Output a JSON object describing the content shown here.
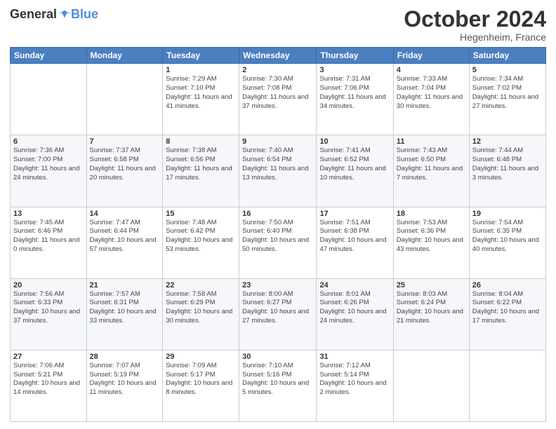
{
  "header": {
    "logo": {
      "general": "General",
      "blue": "Blue"
    },
    "title": "October 2024",
    "location": "Hegenheim, France"
  },
  "calendar": {
    "days_of_week": [
      "Sunday",
      "Monday",
      "Tuesday",
      "Wednesday",
      "Thursday",
      "Friday",
      "Saturday"
    ],
    "weeks": [
      [
        null,
        null,
        {
          "day": 1,
          "sunrise": "7:29 AM",
          "sunset": "7:10 PM",
          "daylight": "11 hours and 41 minutes."
        },
        {
          "day": 2,
          "sunrise": "7:30 AM",
          "sunset": "7:08 PM",
          "daylight": "11 hours and 37 minutes."
        },
        {
          "day": 3,
          "sunrise": "7:31 AM",
          "sunset": "7:06 PM",
          "daylight": "11 hours and 34 minutes."
        },
        {
          "day": 4,
          "sunrise": "7:33 AM",
          "sunset": "7:04 PM",
          "daylight": "11 hours and 30 minutes."
        },
        {
          "day": 5,
          "sunrise": "7:34 AM",
          "sunset": "7:02 PM",
          "daylight": "11 hours and 27 minutes."
        }
      ],
      [
        {
          "day": 6,
          "sunrise": "7:36 AM",
          "sunset": "7:00 PM",
          "daylight": "11 hours and 24 minutes."
        },
        {
          "day": 7,
          "sunrise": "7:37 AM",
          "sunset": "6:58 PM",
          "daylight": "11 hours and 20 minutes."
        },
        {
          "day": 8,
          "sunrise": "7:38 AM",
          "sunset": "6:56 PM",
          "daylight": "11 hours and 17 minutes."
        },
        {
          "day": 9,
          "sunrise": "7:40 AM",
          "sunset": "6:54 PM",
          "daylight": "11 hours and 13 minutes."
        },
        {
          "day": 10,
          "sunrise": "7:41 AM",
          "sunset": "6:52 PM",
          "daylight": "11 hours and 10 minutes."
        },
        {
          "day": 11,
          "sunrise": "7:43 AM",
          "sunset": "6:50 PM",
          "daylight": "11 hours and 7 minutes."
        },
        {
          "day": 12,
          "sunrise": "7:44 AM",
          "sunset": "6:48 PM",
          "daylight": "11 hours and 3 minutes."
        }
      ],
      [
        {
          "day": 13,
          "sunrise": "7:45 AM",
          "sunset": "6:46 PM",
          "daylight": "11 hours and 0 minutes."
        },
        {
          "day": 14,
          "sunrise": "7:47 AM",
          "sunset": "6:44 PM",
          "daylight": "10 hours and 57 minutes."
        },
        {
          "day": 15,
          "sunrise": "7:48 AM",
          "sunset": "6:42 PM",
          "daylight": "10 hours and 53 minutes."
        },
        {
          "day": 16,
          "sunrise": "7:50 AM",
          "sunset": "6:40 PM",
          "daylight": "10 hours and 50 minutes."
        },
        {
          "day": 17,
          "sunrise": "7:51 AM",
          "sunset": "6:38 PM",
          "daylight": "10 hours and 47 minutes."
        },
        {
          "day": 18,
          "sunrise": "7:53 AM",
          "sunset": "6:36 PM",
          "daylight": "10 hours and 43 minutes."
        },
        {
          "day": 19,
          "sunrise": "7:54 AM",
          "sunset": "6:35 PM",
          "daylight": "10 hours and 40 minutes."
        }
      ],
      [
        {
          "day": 20,
          "sunrise": "7:56 AM",
          "sunset": "6:33 PM",
          "daylight": "10 hours and 37 minutes."
        },
        {
          "day": 21,
          "sunrise": "7:57 AM",
          "sunset": "6:31 PM",
          "daylight": "10 hours and 33 minutes."
        },
        {
          "day": 22,
          "sunrise": "7:58 AM",
          "sunset": "6:29 PM",
          "daylight": "10 hours and 30 minutes."
        },
        {
          "day": 23,
          "sunrise": "8:00 AM",
          "sunset": "6:27 PM",
          "daylight": "10 hours and 27 minutes."
        },
        {
          "day": 24,
          "sunrise": "8:01 AM",
          "sunset": "6:26 PM",
          "daylight": "10 hours and 24 minutes."
        },
        {
          "day": 25,
          "sunrise": "8:03 AM",
          "sunset": "6:24 PM",
          "daylight": "10 hours and 21 minutes."
        },
        {
          "day": 26,
          "sunrise": "8:04 AM",
          "sunset": "6:22 PM",
          "daylight": "10 hours and 17 minutes."
        }
      ],
      [
        {
          "day": 27,
          "sunrise": "7:06 AM",
          "sunset": "5:21 PM",
          "daylight": "10 hours and 14 minutes."
        },
        {
          "day": 28,
          "sunrise": "7:07 AM",
          "sunset": "5:19 PM",
          "daylight": "10 hours and 11 minutes."
        },
        {
          "day": 29,
          "sunrise": "7:09 AM",
          "sunset": "5:17 PM",
          "daylight": "10 hours and 8 minutes."
        },
        {
          "day": 30,
          "sunrise": "7:10 AM",
          "sunset": "5:16 PM",
          "daylight": "10 hours and 5 minutes."
        },
        {
          "day": 31,
          "sunrise": "7:12 AM",
          "sunset": "5:14 PM",
          "daylight": "10 hours and 2 minutes."
        },
        null,
        null
      ]
    ]
  }
}
